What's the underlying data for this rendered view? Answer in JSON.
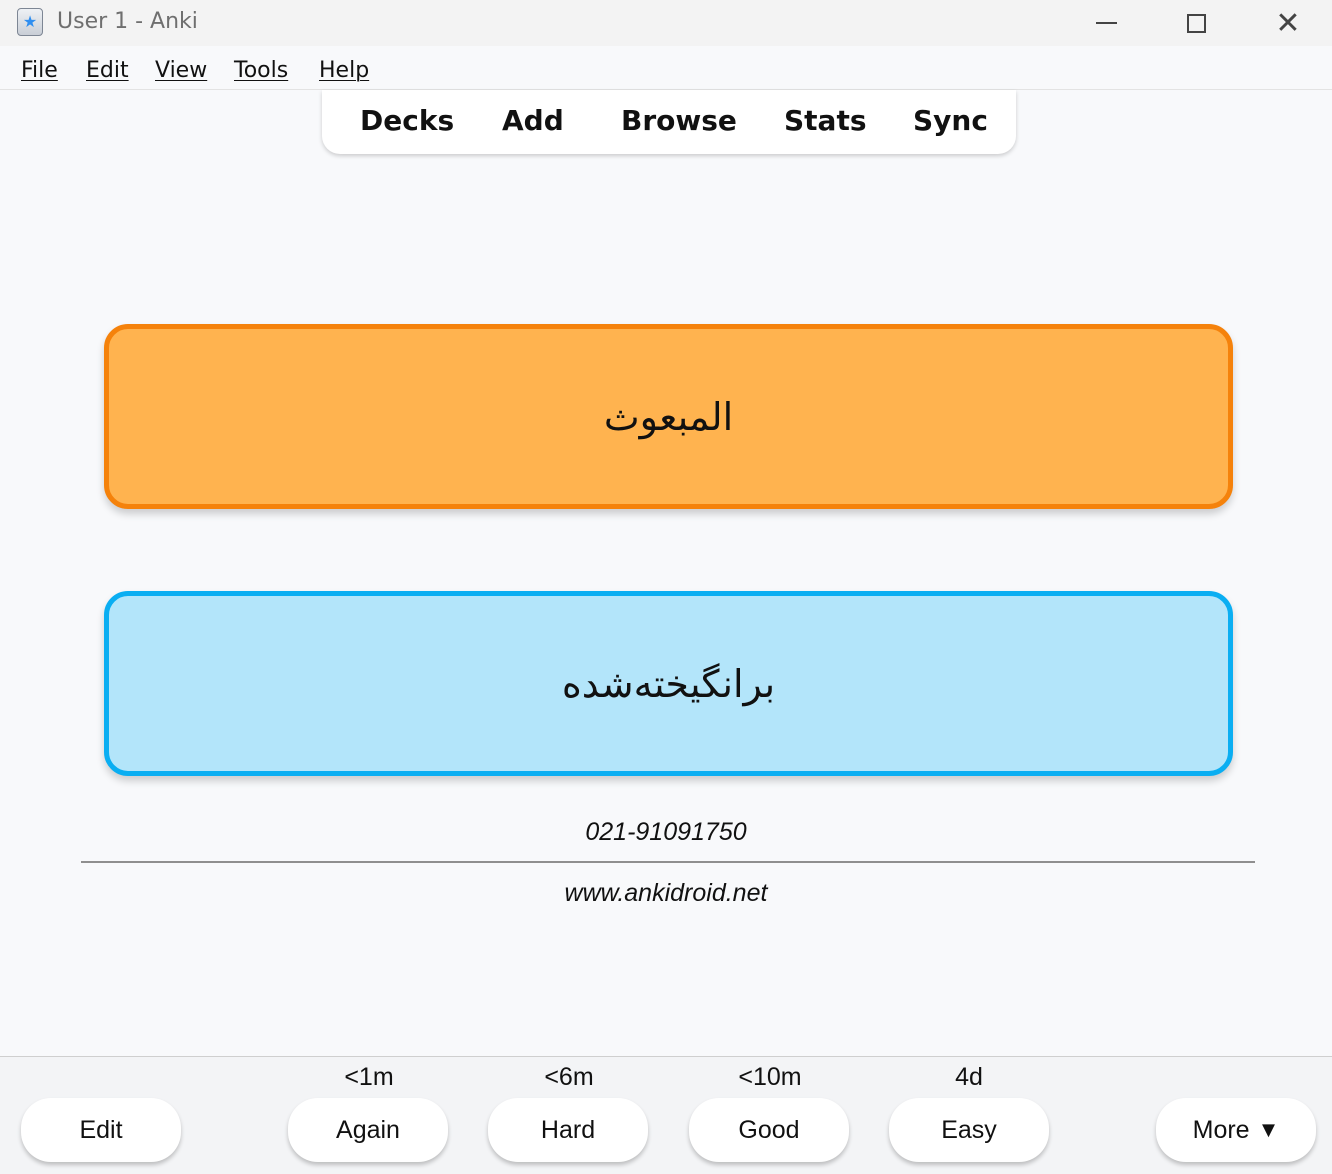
{
  "window": {
    "title": "User 1 - Anki",
    "app_icon": "star-icon",
    "controls": {
      "minimize": "minimize-icon",
      "maximize": "maximize-icon",
      "close": "close-icon"
    }
  },
  "menu": {
    "items": [
      {
        "label": "File"
      },
      {
        "label": "Edit"
      },
      {
        "label": "View"
      },
      {
        "label": "Tools"
      },
      {
        "label": "Help"
      }
    ]
  },
  "toolbar": {
    "items": [
      {
        "label": "Decks"
      },
      {
        "label": "Add"
      },
      {
        "label": "Browse"
      },
      {
        "label": "Stats"
      },
      {
        "label": "Sync"
      }
    ]
  },
  "card": {
    "front_text": "المبعوث",
    "back_text": "برانگیخته‌شده",
    "front_colors": {
      "fill": "#ffb34f",
      "border": "#f5820b"
    },
    "back_colors": {
      "fill": "#b3e5fa",
      "border": "#0aaef2"
    },
    "phone": "021-91091750",
    "website": "www.ankidroid.net"
  },
  "answer_bar": {
    "edit_label": "Edit",
    "buttons": [
      {
        "label": "Again",
        "interval": "<1m"
      },
      {
        "label": "Hard",
        "interval": "<6m"
      },
      {
        "label": "Good",
        "interval": "<10m"
      },
      {
        "label": "Easy",
        "interval": "4d"
      }
    ],
    "more_label": "More",
    "more_arrow": "▼"
  }
}
